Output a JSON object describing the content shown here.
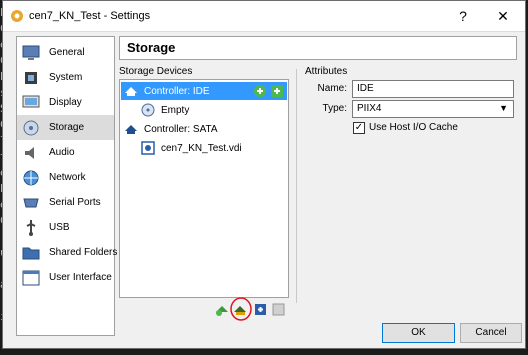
{
  "background_terminal": {
    "lines": [
      "P",
      "C",
      "e",
      "Cl",
      "ba",
      "se",
      "Sl",
      "C",
      "lie",
      "t",
      "e",
      "ba",
      "e",
      "Cu",
      "ue",
      "aj",
      "is"
    ]
  },
  "window": {
    "title": "cen7_KN_Test - Settings",
    "help_label": "?",
    "close_label": "✕"
  },
  "sidebar": {
    "items": [
      {
        "label": "General",
        "icon": "general-monitor-icon"
      },
      {
        "label": "System",
        "icon": "system-chip-icon"
      },
      {
        "label": "Display",
        "icon": "display-monitor-icon"
      },
      {
        "label": "Storage",
        "icon": "storage-disk-icon",
        "selected": true
      },
      {
        "label": "Audio",
        "icon": "audio-speaker-icon"
      },
      {
        "label": "Network",
        "icon": "network-globe-icon"
      },
      {
        "label": "Serial Ports",
        "icon": "serial-port-icon"
      },
      {
        "label": "USB",
        "icon": "usb-icon"
      },
      {
        "label": "Shared Folders",
        "icon": "shared-folder-icon"
      },
      {
        "label": "User Interface",
        "icon": "user-interface-icon"
      }
    ]
  },
  "header": {
    "title": "Storage"
  },
  "storage_devices": {
    "label": "Storage Devices",
    "tree": [
      {
        "label": "Controller: IDE",
        "type": "controller-ide",
        "selected": true
      },
      {
        "label": "Empty",
        "type": "optical-drive"
      },
      {
        "label": "Controller: SATA",
        "type": "controller-sata"
      },
      {
        "label": "cen7_KN_Test.vdi",
        "type": "hard-disk"
      }
    ]
  },
  "attributes": {
    "label": "Attributes",
    "name_label": "Name:",
    "name_value": "IDE",
    "type_label": "Type:",
    "type_value": "PIIX4",
    "host_io_label": "Use Host I/O Cache",
    "host_io_checked": "✓"
  },
  "buttons": {
    "ok": "OK",
    "cancel": "Cancel"
  },
  "colors": {
    "selection": "#3399ff",
    "accent": "#0078d7",
    "annotation": "#e0141e"
  }
}
